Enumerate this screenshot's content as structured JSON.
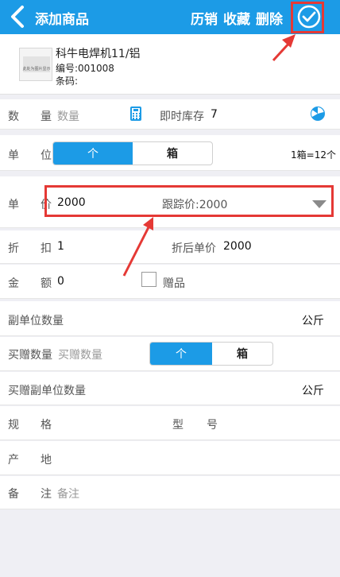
{
  "header": {
    "title": "添加商品",
    "history_label": "历销",
    "favorite_label": "收藏",
    "delete_label": "删除",
    "bg_color": "#1c9be6"
  },
  "product": {
    "image_caption": "此处为图片显示",
    "name": "科牛电焊机11/铝",
    "code": "编号:001008",
    "barcode": "条码:"
  },
  "quantity_row": {
    "label_char1": "数",
    "label_char2": "量",
    "placeholder": "数量",
    "stock_label": "即时库存",
    "stock_value": "7"
  },
  "unit_row": {
    "label_char1": "单",
    "label_char2": "位",
    "unit_a": "个",
    "unit_b": "箱",
    "conversion": "1箱=12个"
  },
  "price_row": {
    "label_char1": "单",
    "label_char2": "价",
    "price_value": "2000",
    "tracking_price": "跟踪价:2000"
  },
  "discount_row": {
    "label_char1": "折",
    "label_char2": "扣",
    "discount_value": "1",
    "after_label": "折后单价",
    "after_value": "2000"
  },
  "amount_row": {
    "label_char1": "金",
    "label_char2": "额",
    "amount_value": "0",
    "gift_label": "赠品"
  },
  "sub_unit_row": {
    "label": "副单位数量",
    "unit": "公斤"
  },
  "bonus_qty_row": {
    "label": "买赠数量",
    "placeholder": "买赠数量",
    "unit_a": "个",
    "unit_b": "箱"
  },
  "bonus_sub_unit_row": {
    "label": "买赠副单位数量",
    "unit": "公斤"
  },
  "spec_row": {
    "label_char1": "规",
    "label_char2": "格",
    "model_char1": "型",
    "model_char2": "号"
  },
  "origin_row": {
    "label_char1": "产",
    "label_char2": "地"
  },
  "remark_row": {
    "label_char1": "备",
    "label_char2": "注",
    "placeholder": "备注"
  },
  "colors": {
    "accent": "#1c9be6",
    "highlight": "#e53935"
  }
}
